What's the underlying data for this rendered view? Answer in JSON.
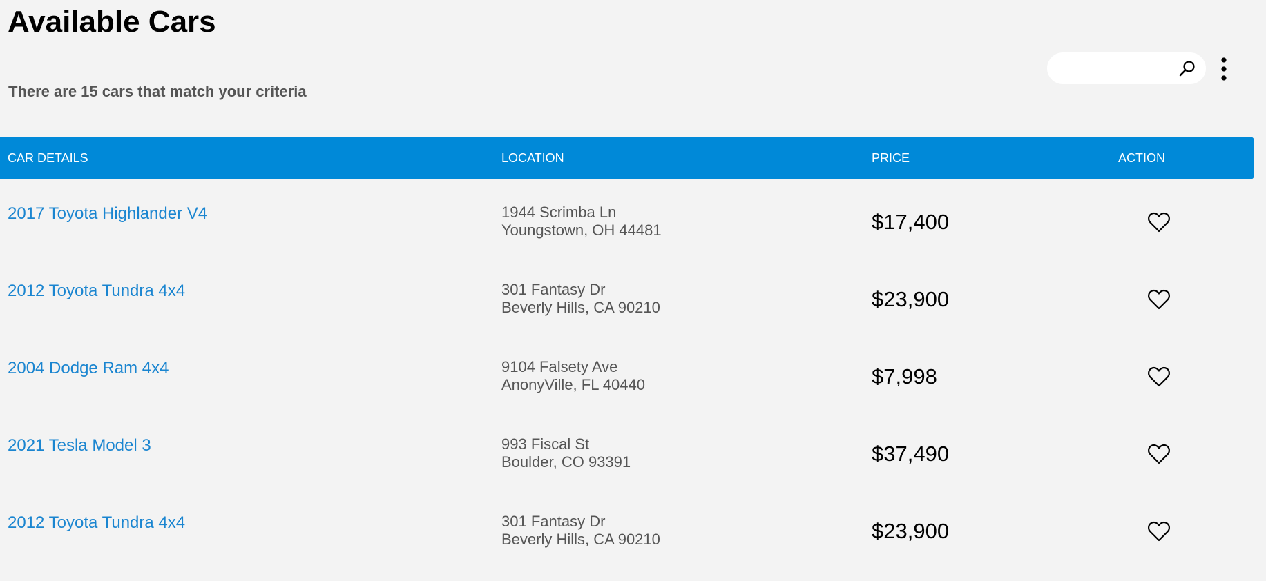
{
  "page": {
    "title": "Available Cars",
    "result_count": "There are 15 cars that match your criteria"
  },
  "search": {
    "value": "",
    "placeholder": ""
  },
  "icons": {
    "search": "search-icon",
    "more": "more-vertical-icon",
    "favorite": "heart-outline-icon"
  },
  "colors": {
    "header_bg": "#0089d8",
    "link": "#1a85d0",
    "page_bg": "#f3f3f3"
  },
  "table": {
    "columns": [
      "CAR DETAILS",
      "LOCATION",
      "PRICE",
      "ACTION"
    ],
    "rows": [
      {
        "car": "2017 Toyota Highlander V4",
        "street": "1944 Scrimba Ln",
        "city": "Youngstown, OH 44481",
        "price": "$17,400"
      },
      {
        "car": "2012 Toyota Tundra 4x4",
        "street": "301 Fantasy Dr",
        "city": "Beverly Hills, CA 90210",
        "price": "$23,900"
      },
      {
        "car": "2004 Dodge Ram 4x4",
        "street": "9104 Falsety Ave",
        "city": "AnonyVille, FL 40440",
        "price": "$7,998"
      },
      {
        "car": "2021 Tesla Model 3",
        "street": "993 Fiscal St",
        "city": "Boulder, CO 93391",
        "price": "$37,490"
      },
      {
        "car": "2012 Toyota Tundra 4x4",
        "street": "301 Fantasy Dr",
        "city": "Beverly Hills, CA 90210",
        "price": "$23,900"
      }
    ]
  }
}
